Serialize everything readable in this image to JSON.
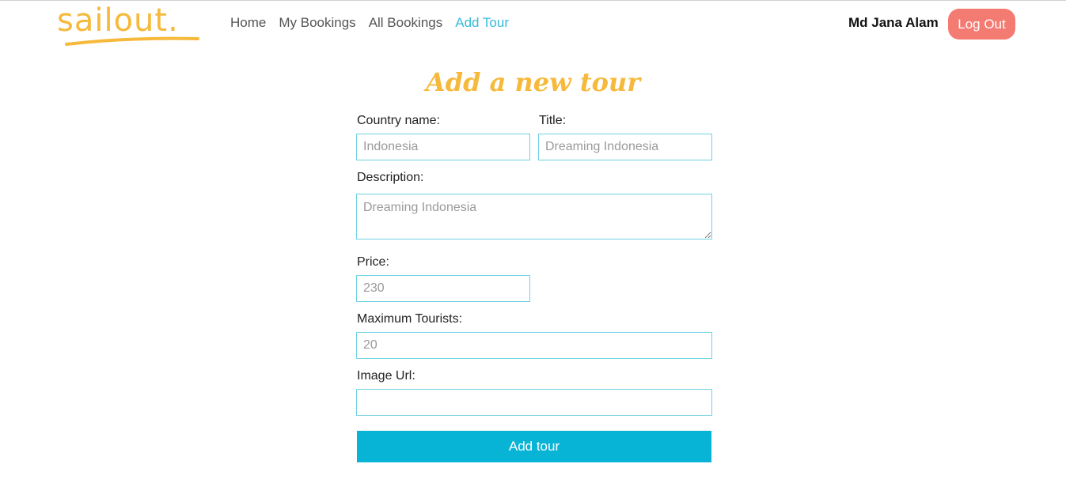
{
  "brand": {
    "logo_text": "sailout."
  },
  "nav": {
    "links": [
      {
        "label": "Home"
      },
      {
        "label": "My Bookings"
      },
      {
        "label": "All Bookings"
      },
      {
        "label": "Add Tour"
      }
    ],
    "active_link": "Add Tour",
    "user_name": "Md Jana Alam",
    "logout_label": "Log Out"
  },
  "form": {
    "heading": "Add a new tour",
    "country": {
      "label": "Country name:",
      "placeholder": "Indonesia"
    },
    "title": {
      "label": "Title:",
      "placeholder": "Dreaming Indonesia"
    },
    "description": {
      "label": "Description:",
      "placeholder": "Dreaming Indonesia"
    },
    "price": {
      "label": "Price:",
      "placeholder": "230"
    },
    "max_tourists": {
      "label": "Maximum Tourists:",
      "placeholder": "20"
    },
    "image_url": {
      "label": "Image Url:",
      "placeholder": ""
    },
    "submit_label": "Add tour"
  },
  "colors": {
    "brand_yellow": "#f6b93b",
    "active_link": "#36bbd8",
    "logout_button": "#f47b72",
    "submit_button": "#08b4d6",
    "input_border": "#6ed2e2"
  }
}
